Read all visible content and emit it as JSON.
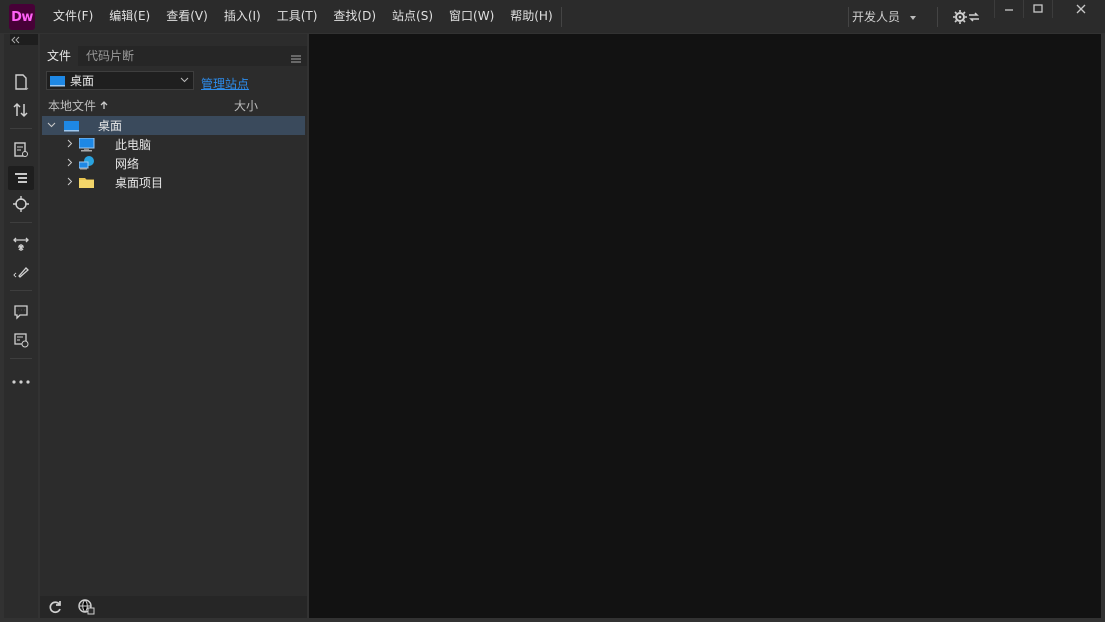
{
  "app": {
    "logo_text": "Dw"
  },
  "menubar": {
    "items": [
      "文件(F)",
      "编辑(E)",
      "查看(V)",
      "插入(I)",
      "工具(T)",
      "查找(D)",
      "站点(S)",
      "窗口(W)",
      "帮助(H)"
    ]
  },
  "workspace": {
    "label": "开发人员"
  },
  "files_panel": {
    "tabs": [
      "文件",
      "代码片断"
    ],
    "site_select": {
      "value": "桌面"
    },
    "manage_link": "管理站点",
    "columns": {
      "name": "本地文件",
      "size": "大小"
    },
    "tree": [
      {
        "label": "桌面",
        "icon": "desktop-icon",
        "expanded": true,
        "selected": true
      },
      {
        "label": "此电脑",
        "icon": "computer-icon"
      },
      {
        "label": "网络",
        "icon": "network-icon"
      },
      {
        "label": "桌面项目",
        "icon": "folder-icon"
      }
    ]
  },
  "colors": {
    "accent": "#ff61f6",
    "logo_bg": "#470137",
    "link": "#2d8ceb",
    "selection": "#3a4a5c"
  }
}
